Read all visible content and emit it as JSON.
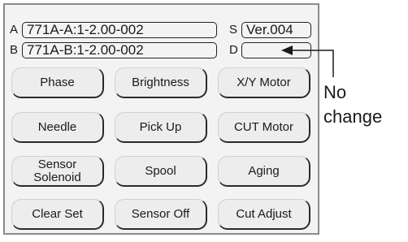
{
  "fields": {
    "a_label": "A",
    "a_value": "771A-A:1-2.00-002",
    "b_label": "B",
    "b_value": "771A-B:1-2.00-002",
    "s_label": "S",
    "s_value": "Ver.004",
    "d_label": "D",
    "d_value": ""
  },
  "buttons": [
    [
      "Phase",
      "Brightness",
      "X/Y Motor"
    ],
    [
      "Needle",
      "Pick Up",
      "CUT Motor"
    ],
    [
      "Sensor\nSolenoid",
      "Spool",
      "Aging"
    ],
    [
      "Clear Set",
      "Sensor Off",
      "Cut Adjust"
    ]
  ],
  "callout": {
    "text": "No\nchange"
  }
}
